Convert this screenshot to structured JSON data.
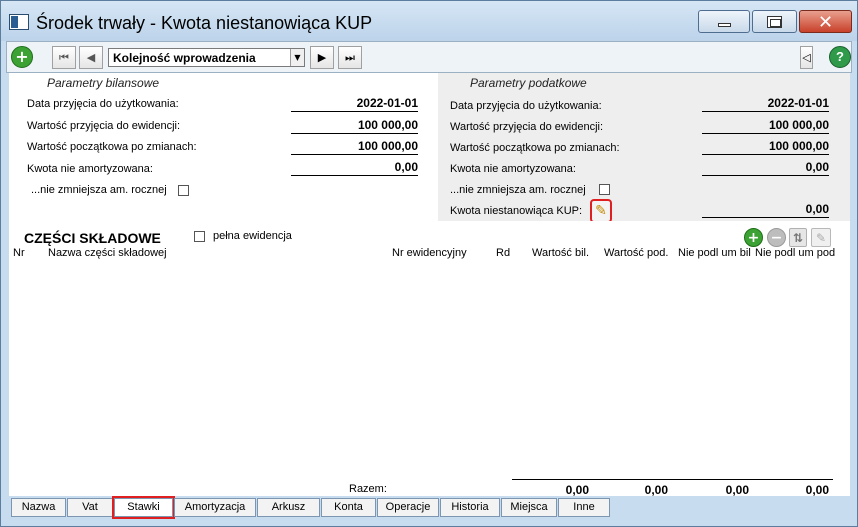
{
  "window": {
    "title": "Środek trwały - Kwota niestanowiąca KUP"
  },
  "toolbar": {
    "order_value": "Kolejność wprowadzenia"
  },
  "bilansowe": {
    "header": "Parametry bilansowe",
    "rows": [
      {
        "label": "Data przyjęcia do użytkowania:",
        "value": "2022-01-01"
      },
      {
        "label": "Wartość przyjęcia do ewidencji:",
        "value": "100 000,00"
      },
      {
        "label": "Wartość początkowa po zmianach:",
        "value": "100 000,00"
      },
      {
        "label": "Kwota nie amortyzowana:",
        "value": "0,00"
      }
    ],
    "checkbox_label": "...nie zmniejsza am. rocznej"
  },
  "podatkowe": {
    "header": "Parametry podatkowe",
    "rows": [
      {
        "label": "Data przyjęcia do użytkowania:",
        "value": "2022-01-01"
      },
      {
        "label": "Wartość przyjęcia do ewidencji:",
        "value": "100 000,00"
      },
      {
        "label": "Wartość początkowa po zmianach:",
        "value": "100 000,00"
      },
      {
        "label": "Kwota nie amortyzowana:",
        "value": "0,00"
      }
    ],
    "checkbox_label": "...nie zmniejsza am. rocznej",
    "kup_label": "Kwota niestanowiąca KUP:",
    "kup_value": "0,00"
  },
  "components": {
    "title": "CZĘŚCI SKŁADOWE",
    "full_record_label": "pełna ewidencja",
    "columns": [
      "Nr",
      "Nazwa części składowej",
      "Nr ewidencyjny",
      "Rd",
      "Wartość bil.",
      "Wartość pod.",
      "Nie podl um bil",
      "Nie podl um pod"
    ],
    "total_label": "Razem:",
    "totals": [
      "0,00",
      "0,00",
      "0,00",
      "0,00"
    ]
  },
  "tabs": [
    "Nazwa",
    "Vat",
    "Stawki",
    "Amortyzacja",
    "Arkusz",
    "Konta",
    "Operacje",
    "Historia",
    "Miejsca",
    "Inne"
  ],
  "active_tab": "Stawki"
}
